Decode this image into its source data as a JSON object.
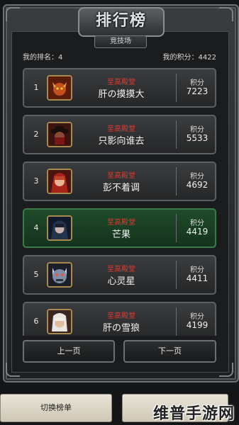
{
  "header": {
    "title": "排行榜",
    "subtitle": "竞技场"
  },
  "info": {
    "my_rank": "我的排名：4",
    "my_points": "我的积分：4422"
  },
  "rows": [
    {
      "rank": "1",
      "hall": "至高殿堂",
      "name": "肝の摸摸大",
      "score_label": "积分",
      "score": "7223",
      "avatar": "horned-demon-avatar"
    },
    {
      "rank": "2",
      "hall": "至高殿堂",
      "name": "只影向谁去",
      "score_label": "积分",
      "score": "5533",
      "avatar": "hatted-gunslinger-avatar"
    },
    {
      "rank": "3",
      "hall": "至高殿堂",
      "name": "彭不着调",
      "score_label": "积分",
      "score": "4692",
      "avatar": "red-hood-girl-avatar"
    },
    {
      "rank": "4",
      "hall": "至高殿堂",
      "name": "芒果",
      "score_label": "积分",
      "score": "4419",
      "avatar": "dark-hood-avatar"
    },
    {
      "rank": "5",
      "hall": "至高殿堂",
      "name": "心灵星",
      "score_label": "积分",
      "score": "4411",
      "avatar": "blue-beast-avatar"
    },
    {
      "rank": "6",
      "hall": "至高殿堂",
      "name": "肝の雪狼",
      "score_label": "积分",
      "score": "4199",
      "avatar": "white-hair-avatar"
    }
  ],
  "pager": {
    "prev": "上一页",
    "next": "下一页"
  },
  "bottom": {
    "switch_list": "切换榜单",
    "second": ""
  },
  "watermark": "维普手游网",
  "colors": {
    "hall_text": "#e23a32",
    "highlight_row": "#1f4a2a"
  }
}
